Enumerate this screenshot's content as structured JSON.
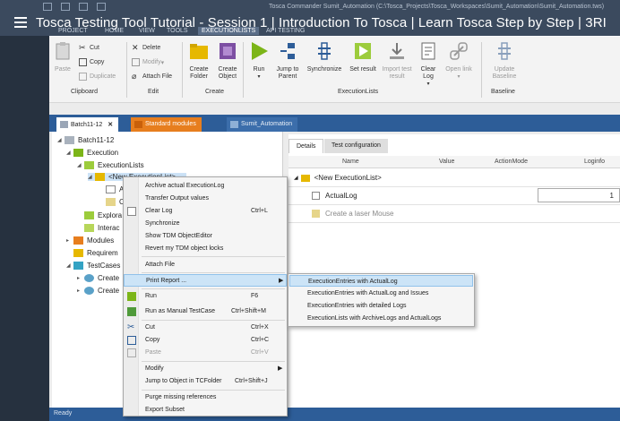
{
  "title_bar": {
    "video_title": "Tosca Testing Tool Tutorial - Session 1 | Introduction To Tosca | Learn Tosca Step by Step | 3RI",
    "window_path": "Tosca Commander Sumit_Automation (C:\\Tosca_Projects\\Tosca_Workspaces\\Sumit_Automation\\Sumit_Automation.tws)",
    "menu_tabs": [
      {
        "label": "PROJECT",
        "active": false
      },
      {
        "label": "HOME",
        "active": false
      },
      {
        "label": "VIEW",
        "active": false
      },
      {
        "label": "TOOLS",
        "active": false
      },
      {
        "label": "EXECUTIONLISTS",
        "active": true
      },
      {
        "label": "API TESTING",
        "active": false
      }
    ]
  },
  "ribbon": {
    "clipboard": {
      "label": "Clipboard",
      "paste": "Paste",
      "cut": "Cut",
      "copy": "Copy",
      "duplicate": "Duplicate"
    },
    "edit": {
      "label": "Edit",
      "delete": "Delete",
      "modify": "Modify",
      "attach_file": "Attach File"
    },
    "create": {
      "label": "Create",
      "create_folder": "Create Folder",
      "create_object": "Create Object"
    },
    "executionlists": {
      "label": "ExecutionLists",
      "run": "Run",
      "jump_to_parent": "Jump to Parent",
      "synchronize": "Synchronize",
      "set_result": "Set result",
      "import_test_result": "Import test result",
      "clear_log": "Clear Log",
      "open_link": "Open link"
    },
    "baseline": {
      "label": "Baseline",
      "update_baseline": "Update Baseline"
    }
  },
  "doc_tabs": [
    {
      "label": "Batch11-12",
      "active": true
    },
    {
      "label": "Standard modules",
      "active": false
    },
    {
      "label": "Sumit_Automation",
      "active": false
    }
  ],
  "tree": {
    "root": "Batch11-12",
    "execution": "Execution",
    "executionlists": "ExecutionLists",
    "new_executionlist": "<New ExecutionList>",
    "a": "A",
    "c": "C",
    "explora": "Explora",
    "interac": "Interac",
    "modules": "Modules",
    "requirem": "Requirem",
    "testcases": "TestCases",
    "create1": "Create",
    "create2": "Create"
  },
  "detail": {
    "tabs": [
      "Details",
      "Test configuration"
    ],
    "columns": [
      "Name",
      "Value",
      "ActionMode",
      "Loginfo"
    ],
    "rows": [
      {
        "name": "<New ExecutionList>"
      },
      {
        "name": "ActualLog",
        "loginfo": "1"
      },
      {
        "name": "Create a laser Mouse"
      }
    ]
  },
  "context_menu": {
    "items": [
      {
        "label": "Archive actual ExecutionLog"
      },
      {
        "label": "Transfer Output values"
      },
      {
        "label": "Clear Log",
        "shortcut": "Ctrl+L"
      },
      {
        "label": "Synchronize"
      },
      {
        "label": "Show TDM ObjectEditor"
      },
      {
        "label": "Revert my TDM object locks"
      },
      {
        "label": "Attach File"
      },
      {
        "label": "Print Report ..."
      },
      {
        "label": "Run",
        "shortcut": "F6"
      },
      {
        "label": "Run as Manual TestCase",
        "shortcut": "Ctrl+Shift+M"
      },
      {
        "label": "Cut",
        "shortcut": "Ctrl+X"
      },
      {
        "label": "Copy",
        "shortcut": "Ctrl+C"
      },
      {
        "label": "Paste",
        "shortcut": "Ctrl+V"
      },
      {
        "label": "Modify"
      },
      {
        "label": "Jump to Object in TCFolder",
        "shortcut": "Ctrl+Shift+J"
      },
      {
        "label": "Purge missing references"
      },
      {
        "label": "Export Subset"
      }
    ]
  },
  "submenu": {
    "items": [
      "ExecutionEntries with ActualLog",
      "ExecutionEntries with ActualLog and Issues",
      "ExecutionEntries with detailed Logs",
      "ExecutionLists with ArchiveLogs and ActualLogs"
    ]
  },
  "status": "Ready",
  "colors": {
    "accent_blue": "#2d5d98",
    "folder_yellow": "#e6b800",
    "green": "#7cb518",
    "orange": "#e77e1e",
    "highlight": "#cce4f7"
  }
}
